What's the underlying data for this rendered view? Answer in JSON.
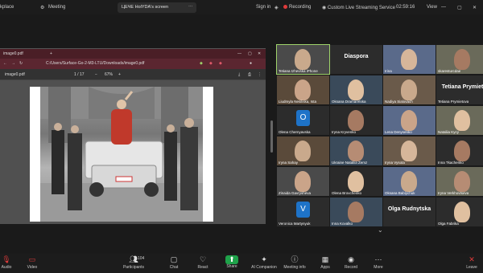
{
  "topbar": {
    "app_fragment": "kplace",
    "meeting_label": "Meeting",
    "screen_owner": "ЦЕЧЕ HolYDA's screen",
    "sign_in": "Sign in",
    "recording": "Recording",
    "streaming": "Custom Live Streaming Service",
    "timer": "02:59:16",
    "view": "View"
  },
  "pdf": {
    "address": "C:/Users/Surface-Go-2-M3-LTU/Downloads/image0.pdf",
    "file_label": "image0.pdf",
    "page_info": "1 / 17",
    "zoom": "67%"
  },
  "participants": [
    {
      "name": "Tetiana Izhevska iPhone",
      "big": "",
      "initial": ""
    },
    {
      "name": "",
      "big": "Diaspora",
      "initial": ""
    },
    {
      "name": "Irina",
      "big": "",
      "initial": ""
    },
    {
      "name": "skaresturcdae",
      "big": "",
      "initial": ""
    },
    {
      "name": "Liudmyla Nesiliska, Ista",
      "big": "",
      "initial": ""
    },
    {
      "name": "Oksana Dramaretska",
      "big": "",
      "initial": ""
    },
    {
      "name": "Nadiya Sialovach",
      "big": "",
      "initial": ""
    },
    {
      "name": "Tetiana Prymietova",
      "big": "Tetiana Prymiet",
      "initial": ""
    },
    {
      "name": "Olena Chernyavska",
      "big": "",
      "initial": "O"
    },
    {
      "name": "Iryna Kryvenko",
      "big": "",
      "initial": ""
    },
    {
      "name": "Lena Denysenko",
      "big": "",
      "initial": ""
    },
    {
      "name": "Nataliia Kycy",
      "big": "",
      "initial": ""
    },
    {
      "name": "Iryna Sahay",
      "big": "",
      "initial": ""
    },
    {
      "name": "Ukraine Nataliia Zemz",
      "big": "",
      "initial": ""
    },
    {
      "name": "Iryna Vysota",
      "big": "",
      "initial": ""
    },
    {
      "name": "Inna Tkachenko",
      "big": "",
      "initial": ""
    },
    {
      "name": "Zinaida Gavrysheva",
      "big": "",
      "initial": ""
    },
    {
      "name": "Olena Brovchenko",
      "big": "",
      "initial": ""
    },
    {
      "name": "Oksana Babiychuk",
      "big": "",
      "initial": ""
    },
    {
      "name": "Iryna Verkhovtseva",
      "big": "",
      "initial": ""
    },
    {
      "name": "Veronica Martynyuk",
      "big": "",
      "initial": "V"
    },
    {
      "name": "Inna Kovalko",
      "big": "",
      "initial": ""
    },
    {
      "name": "",
      "big": "Olga Rudnytska",
      "initial": ""
    },
    {
      "name": "Olga Fabrika",
      "big": "",
      "initial": ""
    }
  ],
  "controls": [
    {
      "label": "Audio",
      "icon": "audio-icon"
    },
    {
      "label": "Video",
      "icon": "video-icon"
    },
    {
      "label": "Participants",
      "icon": "participants-icon",
      "count": "104"
    },
    {
      "label": "Chat",
      "icon": "chat-icon"
    },
    {
      "label": "React",
      "icon": "react-icon"
    },
    {
      "label": "Share",
      "icon": "share-icon"
    },
    {
      "label": "AI Companion",
      "icon": "ai-companion-icon"
    },
    {
      "label": "Meeting info",
      "icon": "meeting-info-icon"
    },
    {
      "label": "Apps",
      "icon": "apps-icon"
    },
    {
      "label": "Record",
      "icon": "record-icon"
    },
    {
      "label": "More",
      "icon": "more-icon"
    },
    {
      "label": "Leave",
      "icon": "leave-icon"
    }
  ],
  "colors": {
    "accent_active": "#9fd36a",
    "share": "#1fa24a",
    "leave": "#e03b3b"
  }
}
